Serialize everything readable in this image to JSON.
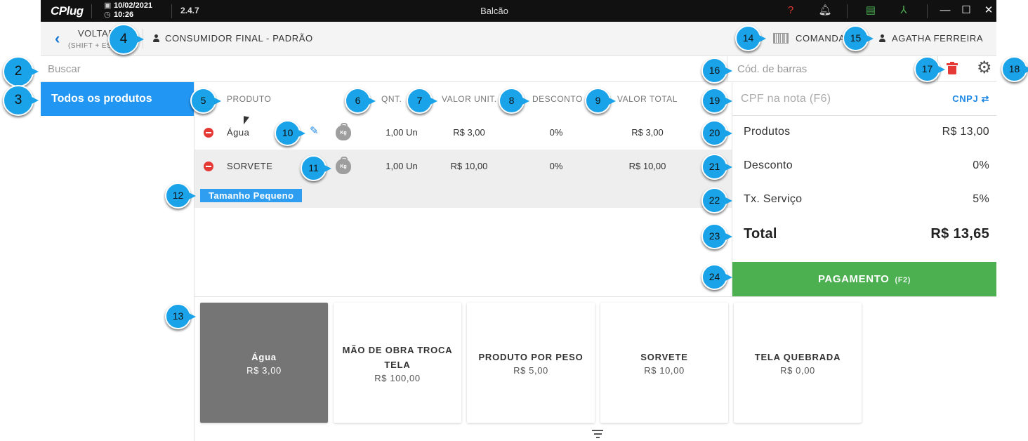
{
  "titlebar": {
    "logo": "CPlug",
    "date": "10/02/2021",
    "time": "10:26",
    "version": "2.4.7",
    "window_title": "Balcão",
    "icons": [
      "help-icon",
      "bell-icon",
      "server-icon",
      "network-icon",
      "minimize-icon",
      "maximize-icon",
      "close-icon"
    ]
  },
  "header": {
    "back_label": "VOLTAR",
    "back_shortcut": "(SHIFT + ESC)",
    "customer": "CONSUMIDOR FINAL - PADRÃO",
    "comanda": "COMANDA",
    "user": "AGATHA FERREIRA"
  },
  "search": {
    "placeholder": "Buscar",
    "barcode_placeholder": "Cód. de barras"
  },
  "sidebar": {
    "category": "Todos os produtos"
  },
  "table": {
    "headers": {
      "product": "PRODUTO",
      "qty": "QNT.",
      "unit": "VALOR UNIT.",
      "discount": "DESCONTO",
      "total": "VALOR TOTAL"
    },
    "rows": [
      {
        "name": "Água",
        "qty": "1,00 Un",
        "unit": "R$ 3,00",
        "discount": "0%",
        "total": "R$ 3,00"
      },
      {
        "name": "SORVETE",
        "qty": "1,00 Un",
        "unit": "R$ 10,00",
        "discount": "0%",
        "total": "R$ 10,00",
        "tag": "Tamanho Pequeno"
      }
    ],
    "kg_label": "Kg"
  },
  "summary": {
    "cpf_placeholder": "CPF na nota (F6)",
    "cnpj_toggle": "CNPJ",
    "products_label": "Produtos",
    "products_value": "R$ 13,00",
    "discount_label": "Desconto",
    "discount_value": "0%",
    "service_label": "Tx. Serviço",
    "service_value": "5%",
    "total_label": "Total",
    "total_value": "R$ 13,65",
    "pay_label": "PAGAMENTO",
    "pay_shortcut": "(F2)"
  },
  "products": [
    {
      "name": "Água",
      "price": "R$ 3,00"
    },
    {
      "name": "MÃO DE OBRA TROCA TELA",
      "price": "R$ 100,00"
    },
    {
      "name": "PRODUTO POR PESO",
      "price": "R$ 5,00"
    },
    {
      "name": "SORVETE",
      "price": "R$ 10,00"
    },
    {
      "name": "TELA QUEBRADA",
      "price": "R$ 0,00"
    }
  ],
  "callouts": [
    "2",
    "3",
    "4",
    "5",
    "6",
    "7",
    "8",
    "9",
    "10",
    "11",
    "12",
    "13",
    "14",
    "15",
    "16",
    "17",
    "18",
    "19",
    "20",
    "21",
    "22",
    "23",
    "24"
  ],
  "colors": {
    "accent": "#2196f3",
    "pay": "#4caf50",
    "danger": "#e53935",
    "callout": "#1aa3e8"
  }
}
